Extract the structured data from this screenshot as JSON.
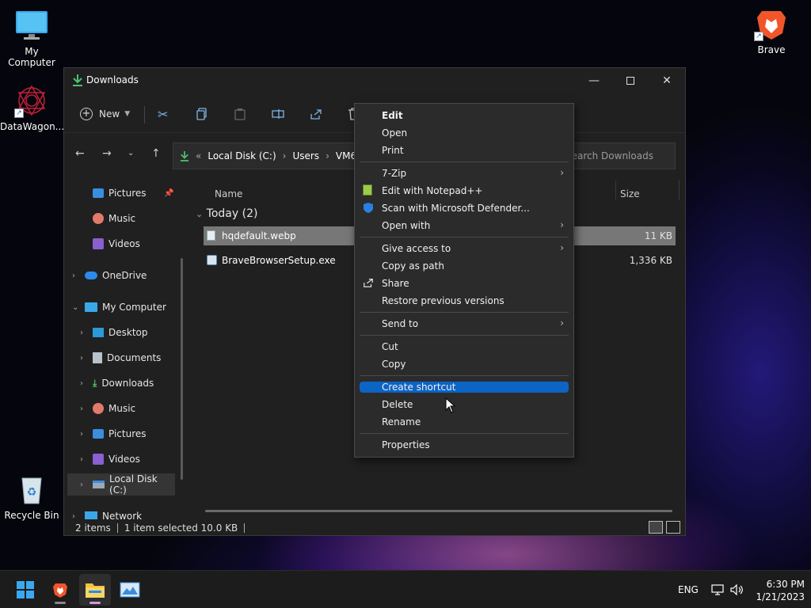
{
  "desktop": {
    "icons": [
      {
        "label": "My Computer"
      },
      {
        "label": "DataWagon..."
      },
      {
        "label": "Brave"
      },
      {
        "label": "Recycle Bin"
      }
    ]
  },
  "window": {
    "title": "Downloads",
    "toolbar": {
      "new_label": "New"
    },
    "address": {
      "segments": [
        "Local Disk (C:)",
        "Users",
        "VM6"
      ],
      "overflow": "«"
    },
    "search_placeholder": "Search Downloads",
    "sidebar": [
      {
        "label": "Pictures",
        "pinned": true
      },
      {
        "label": "Music"
      },
      {
        "label": "Videos"
      },
      {
        "label": "OneDrive"
      },
      {
        "label": "My Computer"
      },
      {
        "label": "Desktop"
      },
      {
        "label": "Documents"
      },
      {
        "label": "Downloads"
      },
      {
        "label": "Music"
      },
      {
        "label": "Pictures"
      },
      {
        "label": "Videos"
      },
      {
        "label": "Local Disk (C:)"
      },
      {
        "label": "Network"
      }
    ],
    "columns": {
      "name": "Name",
      "size": "Size"
    },
    "group": "Today (2)",
    "files": [
      {
        "name": "hqdefault.webp",
        "size": "11 KB",
        "selected": true
      },
      {
        "name": "BraveBrowserSetup.exe",
        "size": "1,336 KB",
        "selected": false
      }
    ],
    "status": {
      "items": "2 items",
      "selected": "1 item selected  10.0 KB"
    }
  },
  "context_menu": {
    "items": [
      {
        "label": "Edit",
        "bold": true
      },
      {
        "label": "Open"
      },
      {
        "label": "Print"
      },
      {
        "label": "7-Zip",
        "submenu": true
      },
      {
        "label": "Edit with Notepad++"
      },
      {
        "label": "Scan with Microsoft Defender..."
      },
      {
        "label": "Open with",
        "submenu": true
      },
      {
        "label": "Give access to",
        "submenu": true
      },
      {
        "label": "Copy as path"
      },
      {
        "label": "Share"
      },
      {
        "label": "Restore previous versions"
      },
      {
        "label": "Send to",
        "submenu": true
      },
      {
        "label": "Cut"
      },
      {
        "label": "Copy"
      },
      {
        "label": "Create shortcut",
        "highlighted": true
      },
      {
        "label": "Delete"
      },
      {
        "label": "Rename"
      },
      {
        "label": "Properties"
      }
    ]
  },
  "taskbar": {
    "language": "ENG",
    "time": "6:30 PM",
    "date": "1/21/2023"
  },
  "colors": {
    "accent": "#0c64c4",
    "window_bg": "#202020",
    "menu_bg": "#2b2b2b"
  }
}
